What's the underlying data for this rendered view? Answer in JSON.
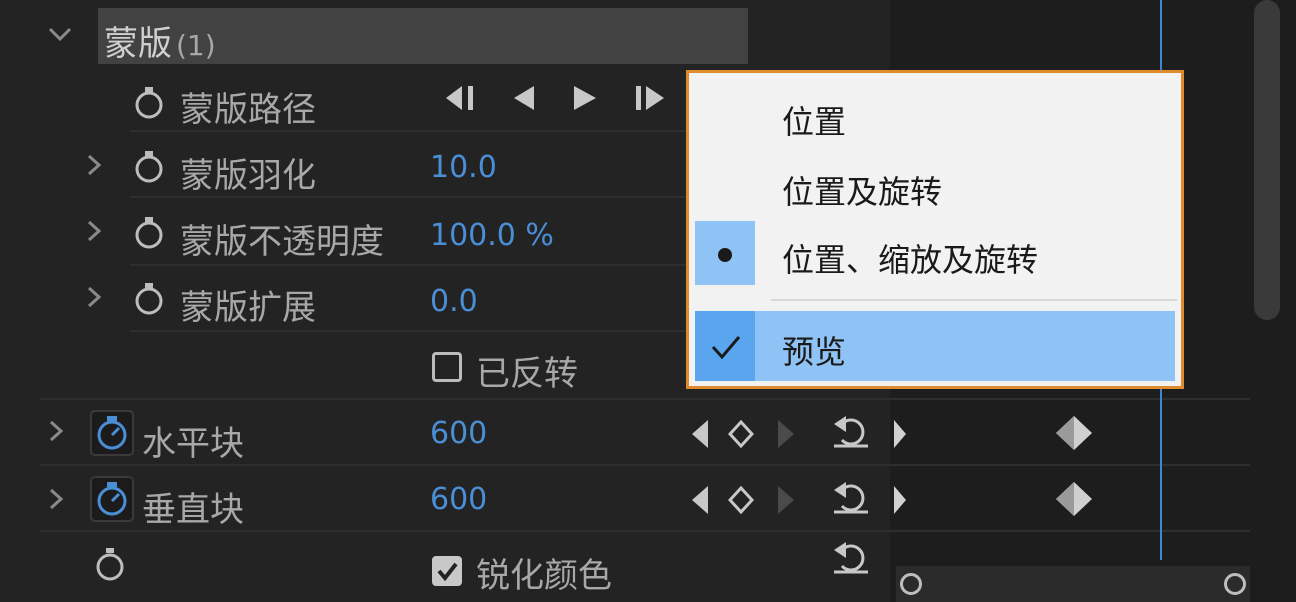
{
  "section": {
    "title": "蒙版",
    "count": "(1)"
  },
  "rows": {
    "mask_path": {
      "label": "蒙版路径"
    },
    "mask_feather": {
      "label": "蒙版羽化",
      "value": "10.0"
    },
    "mask_opacity": {
      "label": "蒙版不透明度",
      "value": "100.0 %"
    },
    "mask_expansion": {
      "label": "蒙版扩展",
      "value": "0.0"
    },
    "inverted": {
      "label": "已反转",
      "checked": false
    },
    "horizontal_blocks": {
      "label": "水平块",
      "value": "600"
    },
    "vertical_blocks": {
      "label": "垂直块",
      "value": "600"
    },
    "sharpen_colors": {
      "label": "锐化颜色",
      "checked": true
    }
  },
  "menu": {
    "items": [
      {
        "label": "位置",
        "mark": ""
      },
      {
        "label": "位置及旋转",
        "mark": ""
      },
      {
        "label": "位置、缩放及旋转",
        "mark": "bullet"
      },
      {
        "label": "预览",
        "mark": "check"
      }
    ]
  },
  "colors": {
    "accent": "#4a8fd6",
    "menu_border": "#e08a2e",
    "menu_highlight": "#8fc3f5",
    "panel_bg": "#232323"
  },
  "icons": [
    "chevron-down-icon",
    "chevron-right-icon",
    "stopwatch-icon",
    "go-to-previous-keyframe-icon",
    "play-reverse-icon",
    "play-icon",
    "go-to-next-keyframe-icon",
    "keyframe-diamond-icon",
    "reset-icon",
    "checkmark-icon",
    "bullet-icon"
  ]
}
